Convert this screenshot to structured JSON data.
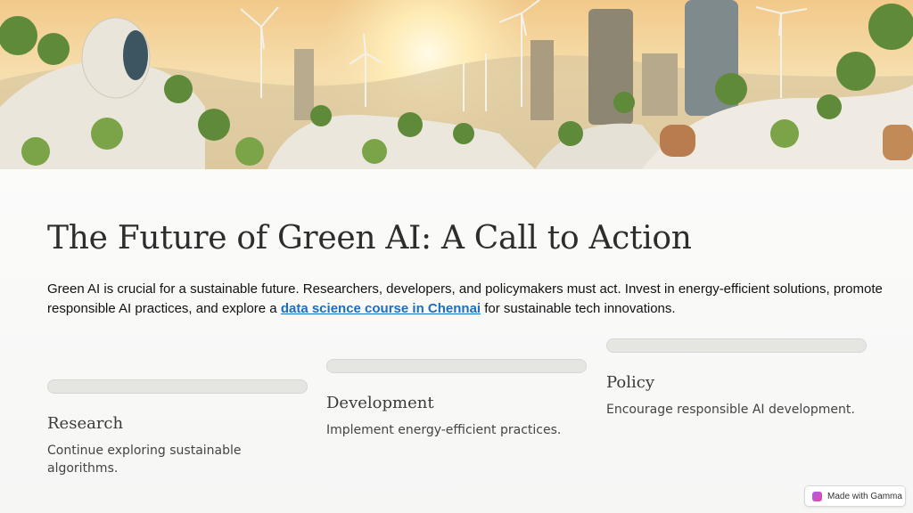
{
  "hero": {
    "alt": "Sustainable futuristic city with wind turbines at sunset"
  },
  "title": "The Future of Green AI: A Call to Action",
  "intro": {
    "before_link": "Green AI is crucial for a sustainable future. Researchers, developers, and policymakers must act. Invest in energy-efficient solutions, promote responsible AI practices, and explore a ",
    "link_text": "data science course in Chennai",
    "after_link": " for sustainable tech innovations."
  },
  "columns": [
    {
      "heading": "Research",
      "text": "Continue exploring sustainable algorithms."
    },
    {
      "heading": "Development",
      "text": "Implement energy-efficient practices."
    },
    {
      "heading": "Policy",
      "text": "Encourage responsible AI development."
    }
  ],
  "badge": {
    "label": "Made with Gamma"
  },
  "colors": {
    "link": "#1a6fc4",
    "bar": "#e5e5e2",
    "background": "#f8f8f7"
  }
}
